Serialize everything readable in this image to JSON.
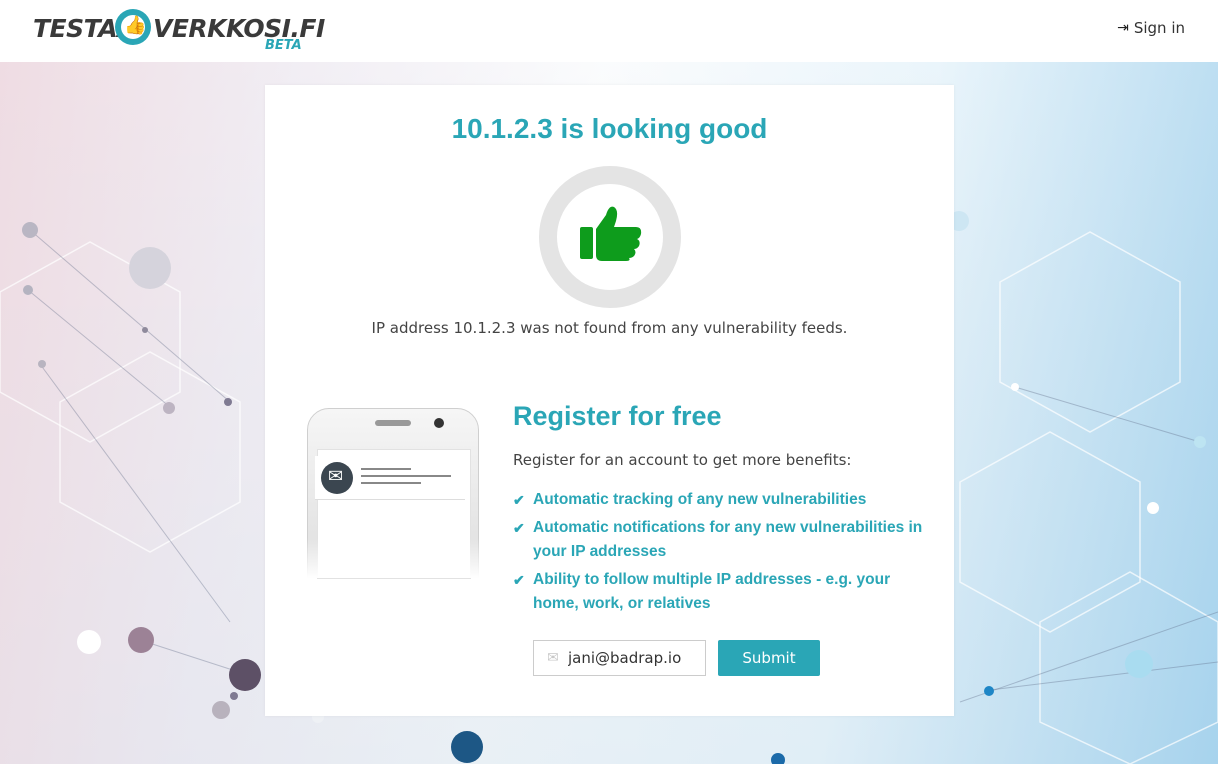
{
  "header": {
    "logo_left": "TESTAA",
    "logo_right": "VERKKOSI.FI",
    "logo_beta": "BETA",
    "signin_label": "Sign in",
    "signin_icon": "sign-in-icon"
  },
  "result": {
    "headline": "10.1.2.3 is looking good",
    "status_icon": "thumbs-up-icon",
    "message": "IP address 10.1.2.3 was not found from any vulnerability feeds."
  },
  "register": {
    "title": "Register for free",
    "subtitle": "Register for an account to get more benefits:",
    "benefits": [
      "Automatic tracking of any new vulnerabilities",
      "Automatic notifications for any new vulnerabilities in your IP addresses",
      "Ability to follow multiple IP addresses - e.g. your home, work, or relatives"
    ],
    "email_value": "jani@badrap.io",
    "email_icon": "envelope-icon",
    "submit_label": "Submit"
  },
  "colors": {
    "accent": "#2aa6b6",
    "thumb": "#0e9c1c",
    "ring": "#e4e4e4"
  }
}
